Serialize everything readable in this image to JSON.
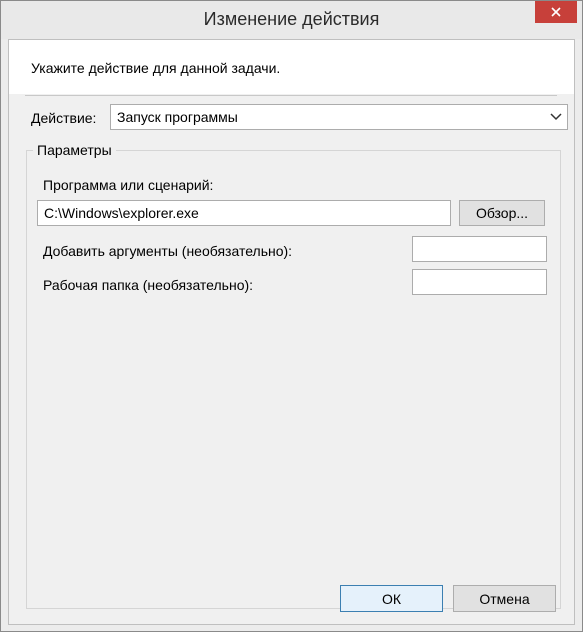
{
  "window": {
    "title": "Изменение действия",
    "close_icon": "close-icon"
  },
  "instruction": "Укажите действие для данной задачи.",
  "action": {
    "label": "Действие:",
    "selected": "Запуск программы",
    "dropdown_icon": "chevron-down-icon"
  },
  "parameters": {
    "title": "Параметры",
    "program_label": "Программа или сценарий:",
    "program_value": "C:\\Windows\\explorer.exe",
    "browse_label": "Обзор...",
    "arguments_label": "Добавить аргументы (необязательно):",
    "arguments_value": "",
    "workdir_label": "Рабочая папка (необязательно):",
    "workdir_value": ""
  },
  "buttons": {
    "ok": "ОК",
    "cancel": "Отмена"
  },
  "colors": {
    "close_button": "#c7403a",
    "default_button_border": "#3c7fb1"
  }
}
